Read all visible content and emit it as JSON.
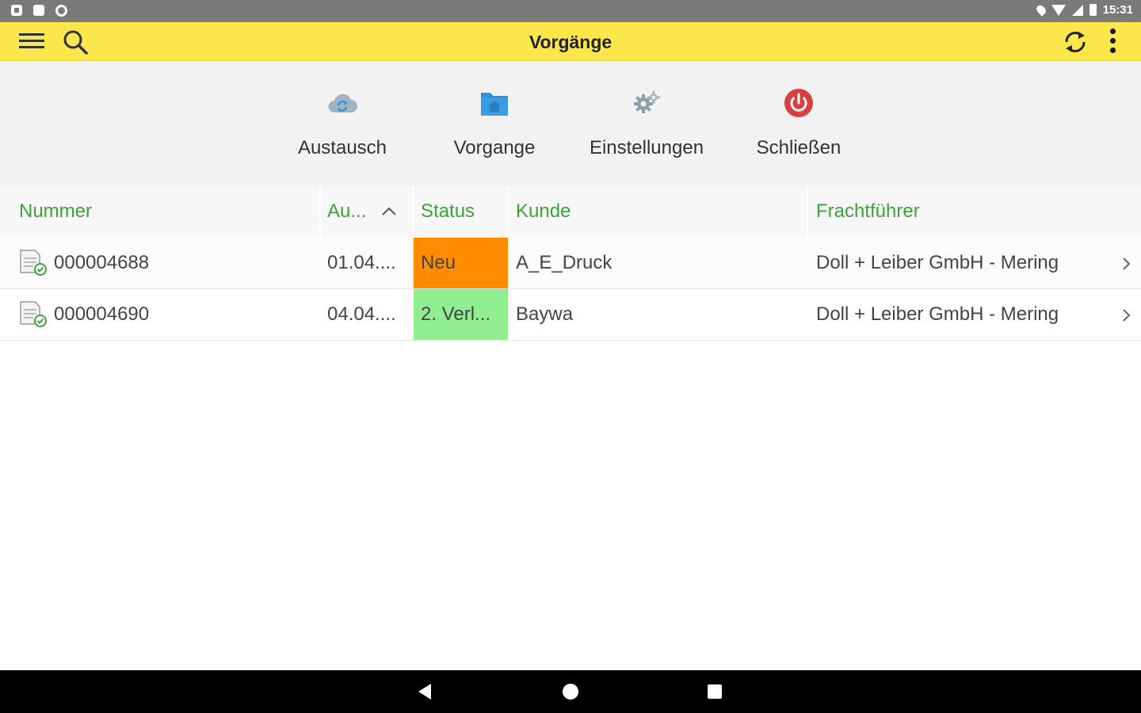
{
  "status_bar": {
    "time": "15:31"
  },
  "app_bar": {
    "title": "Vorgänge",
    "icons": [
      "menu-icon",
      "search-icon",
      "sync-icon",
      "more-vert-icon"
    ]
  },
  "actions": [
    {
      "label": "Austausch",
      "icon": "cloud-sync-icon",
      "color": "#9fb3c4"
    },
    {
      "label": "Vorgange",
      "icon": "folder-home-icon",
      "color": "#2f8fd8"
    },
    {
      "label": "Einstellungen",
      "icon": "gears-icon",
      "color": "#8aa0a8"
    },
    {
      "label": "Schließen",
      "icon": "power-icon",
      "color": "#d84040"
    }
  ],
  "table": {
    "columns": [
      "Nummer",
      "Au...",
      "Status",
      "Kunde",
      "Frachtführer"
    ],
    "sort_column": "Au...",
    "sort_direction": "ascending",
    "header_color": "#3aa43a",
    "rows": [
      {
        "nummer": "000004688",
        "au": "01.04....",
        "status": "Neu",
        "status_color": "#ff8c00",
        "kunde": "A_E_Druck",
        "frachtfuehrer": "Doll + Leiber GmbH - Mering"
      },
      {
        "nummer": "000004690",
        "au": "04.04....",
        "status": "2. Verl...",
        "status_color": "#90ee90",
        "kunde": "Baywa",
        "frachtfuehrer": "Doll + Leiber GmbH - Mering"
      }
    ]
  },
  "theme": {
    "app_bar_color": "#fbe64b",
    "toolbar_bg": "#f2f2f2"
  }
}
